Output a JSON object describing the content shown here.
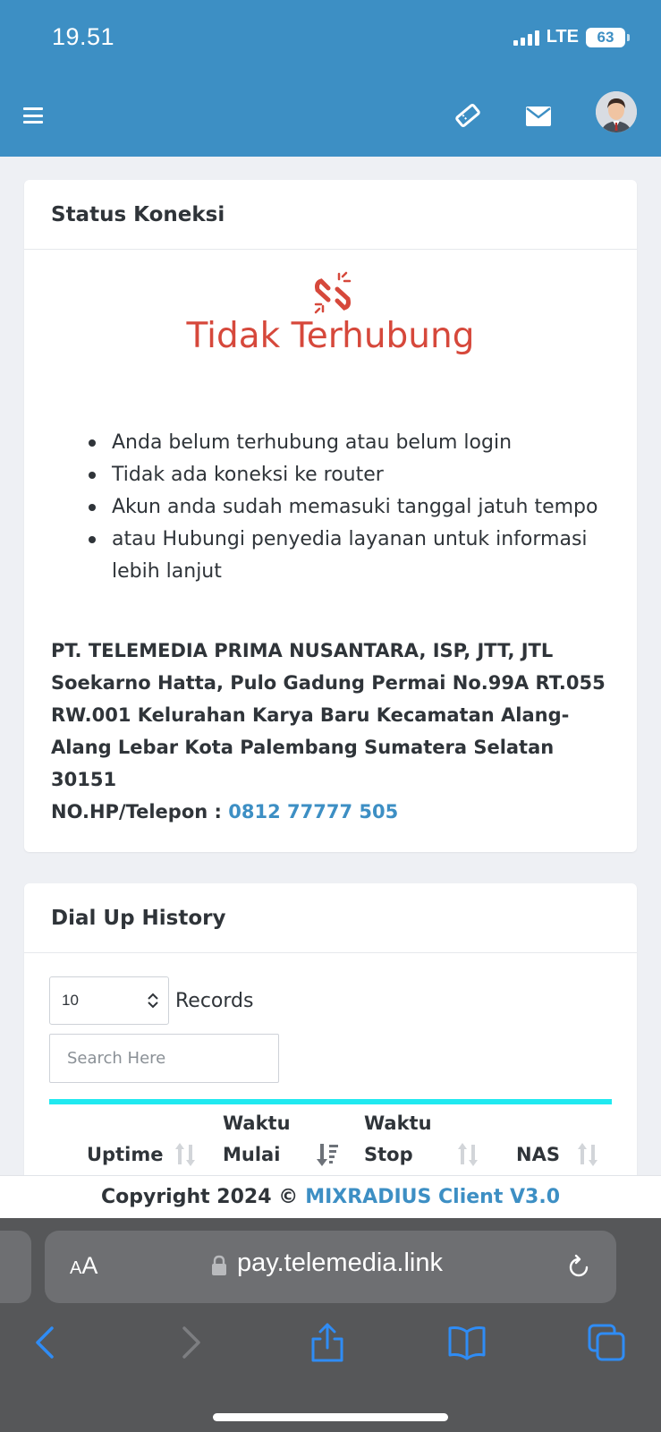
{
  "status_bar": {
    "time": "19.51",
    "network": "LTE",
    "battery": "63"
  },
  "header": {
    "icons": [
      "menu-icon",
      "ticket-icon",
      "mail-icon",
      "user-avatar"
    ],
    "color": "#3d8fc4"
  },
  "status_card": {
    "title": "Status Koneksi",
    "icon": "broken-link-icon",
    "status_text": "Tidak Terhubung",
    "status_color": "#d6483b",
    "reasons": [
      "Anda belum terhubung atau belum login",
      "Tidak ada koneksi ke router",
      "Akun anda sudah memasuki tanggal jatuh tempo",
      "atau Hubungi penyedia layanan untuk informasi lebih lanjut"
    ],
    "company": {
      "name": "PT. TELEMEDIA PRIMA NUSANTARA, ISP, JTT, JTL",
      "address": "Soekarno Hatta, Pulo Gadung Permai No.99A RT.055 RW.001 Kelurahan Karya Baru Kecamatan Alang-Alang Lebar Kota Palembang Sumatera Selatan 30151",
      "phone_label": "NO.HP/Telepon :",
      "phone": "0812 77777 505"
    }
  },
  "dial_card": {
    "title": "Dial Up History",
    "page_size": "10",
    "records_label": "Records",
    "search_placeholder": "Search Here",
    "accent": "#20e9f0",
    "columns": {
      "uptime": "Uptime",
      "start_top": "Waktu",
      "start_bottom": "Mulai",
      "stop_top": "Waktu",
      "stop_bottom": "Stop",
      "nas": "NAS"
    }
  },
  "footer": {
    "copyright": "Copyright 2024 ©",
    "brand": "MIXRADIUS Client V3.0"
  },
  "browser": {
    "text_size_label": "AA",
    "url": "pay.telemedia.link",
    "nav_icons": [
      "back-icon",
      "forward-icon",
      "share-icon",
      "bookmarks-icon",
      "tabs-icon"
    ]
  }
}
